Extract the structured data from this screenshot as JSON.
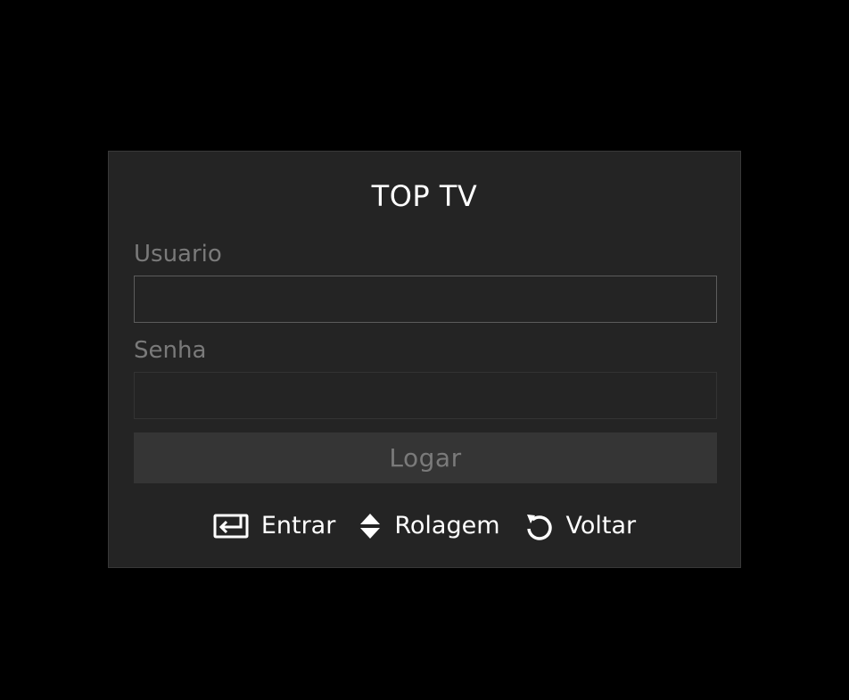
{
  "app": {
    "title": "TOP TV"
  },
  "login_form": {
    "username": {
      "label": "Usuario",
      "value": "",
      "placeholder": ""
    },
    "password": {
      "label": "Senha",
      "value": "",
      "placeholder": ""
    },
    "submit_label": "Logar"
  },
  "key_hints": [
    {
      "icon": "enter-key-icon",
      "label": "Entrar"
    },
    {
      "icon": "up-down-arrows-icon",
      "label": "Rolagem"
    },
    {
      "icon": "back-arrow-icon",
      "label": "Voltar"
    }
  ],
  "colors": {
    "background": "#000000",
    "panel": "#242424",
    "button": "#353535",
    "muted_text": "#7a7a7a",
    "primary_text": "#ffffff"
  }
}
